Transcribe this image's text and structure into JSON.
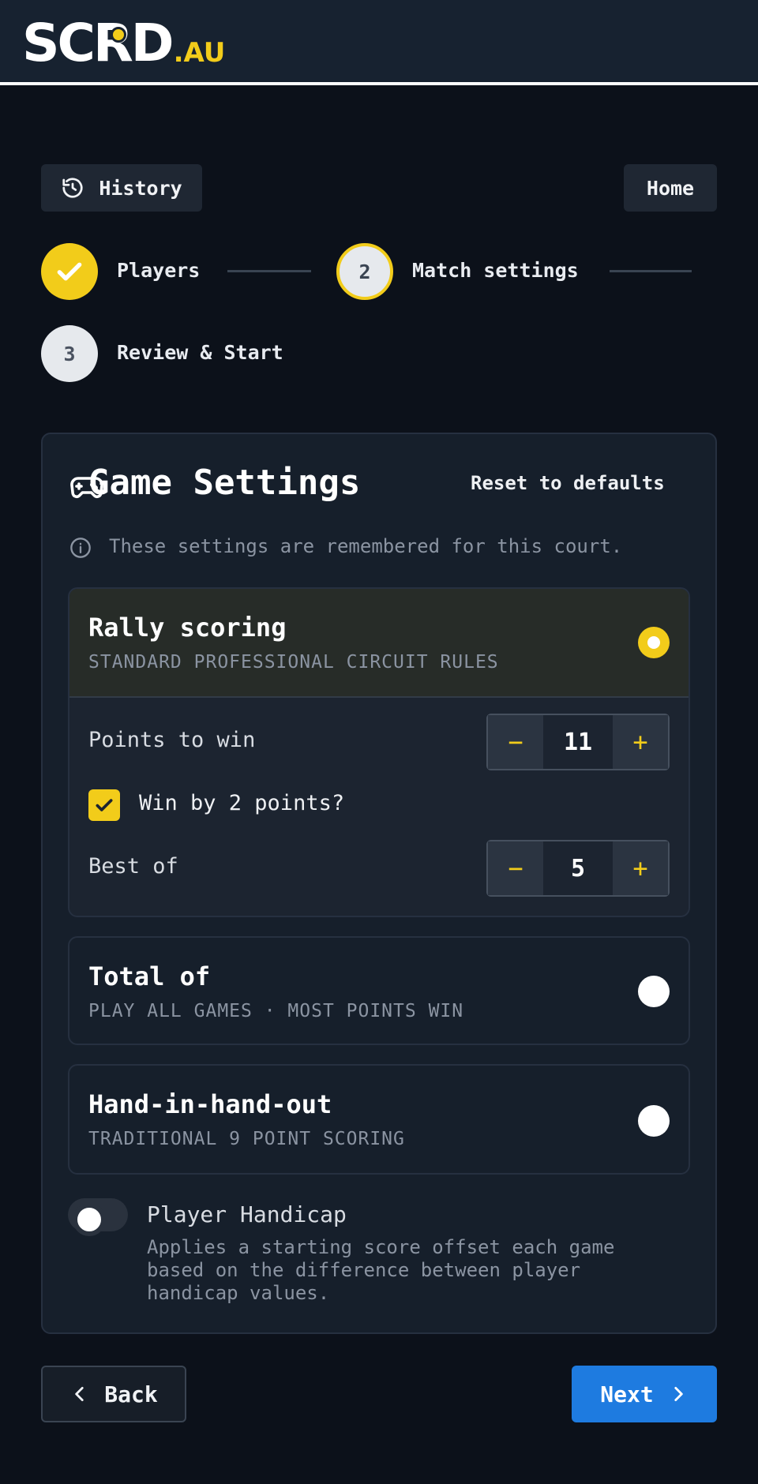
{
  "brand": {
    "name": "SCRD",
    "suffix": ".AU",
    "accent": "#f2cc1a",
    "primary": "#1e7be0"
  },
  "nav": {
    "history_label": "History",
    "history_icon": "history-icon",
    "home_label": "Home"
  },
  "steps": [
    {
      "number": "✓",
      "label": "Players",
      "state": "complete"
    },
    {
      "number": "2",
      "label": "Match settings",
      "state": "current"
    },
    {
      "number": "3",
      "label": "Review & Start",
      "state": "upcoming"
    }
  ],
  "settings": {
    "title": "Game Settings",
    "icon": "gamepad-icon",
    "reset_label": "Reset to defaults",
    "info": "These settings are remembered for this court.",
    "options": [
      {
        "title": "Rally scoring",
        "subtitle": "STANDARD PROFESSIONAL CIRCUIT RULES",
        "selected": true
      },
      {
        "title": "Total of",
        "subtitle": "PLAY ALL GAMES · MOST POINTS WIN",
        "selected": false
      },
      {
        "title": "Hand-in-hand-out",
        "subtitle": "TRADITIONAL 9 POINT SCORING",
        "selected": false
      }
    ],
    "points_to_win": {
      "label": "Points to win",
      "value": "11",
      "minus": "−",
      "plus": "+"
    },
    "win_by_two": {
      "label": "Win by 2 points?",
      "checked": true
    },
    "best_of": {
      "label": "Best of",
      "value": "5",
      "minus": "−",
      "plus": "+"
    },
    "handicap": {
      "label": "Player Handicap",
      "enabled": false,
      "description": "Applies a starting score offset each game based on the difference between player handicap values."
    }
  },
  "footer": {
    "back_label": "Back",
    "next_label": "Next"
  }
}
